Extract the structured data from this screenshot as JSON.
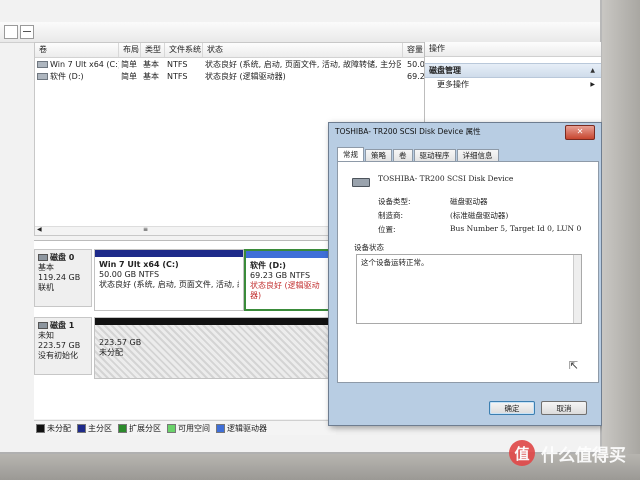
{
  "volume_list": {
    "headers": [
      "卷",
      "布局",
      "类型",
      "文件系统",
      "状态",
      "容量"
    ],
    "rows": [
      {
        "name": "Win 7 Ult x64 (C:)",
        "layout": "简单",
        "type": "基本",
        "fs": "NTFS",
        "status": "状态良好 (系统, 启动, 页面文件, 活动, 故障转储, 主分区)",
        "capacity": "50.0"
      },
      {
        "name": "软件 (D:)",
        "layout": "简单",
        "type": "基本",
        "fs": "NTFS",
        "status": "状态良好 (逻辑驱动器)",
        "capacity": "69.2"
      }
    ]
  },
  "actions": {
    "header": "操作",
    "section": "磁盘管理",
    "item": "更多操作"
  },
  "disks": [
    {
      "name": "磁盘 0",
      "type": "基本",
      "size": "119.24 GB",
      "state": "联机",
      "partitions": [
        {
          "name": "Win 7 Ult x64 (C:)",
          "size": "50.00 GB NTFS",
          "status": "状态良好 (系统, 启动, 页面文件, 活动, 故障转储, 主分区)"
        },
        {
          "name": "软件 (D:)",
          "size": "69.23 GB NTFS",
          "status": "状态良好 (逻辑驱动器)"
        }
      ]
    },
    {
      "name": "磁盘 1",
      "type": "未知",
      "size": "223.57 GB",
      "state": "没有初始化",
      "partitions": [
        {
          "size": "223.57 GB",
          "status": "未分配"
        }
      ]
    }
  ],
  "legend": [
    {
      "label": "未分配",
      "color": "#111111"
    },
    {
      "label": "主分区",
      "color": "#1e2a8a"
    },
    {
      "label": "扩展分区",
      "color": "#2b8a2b"
    },
    {
      "label": "可用空间",
      "color": "#6ad36a"
    },
    {
      "label": "逻辑驱动器",
      "color": "#3f6fd8"
    }
  ],
  "dialog": {
    "title": "TOSHIBA- TR200 SCSI Disk Device 属性",
    "close_label": "✕",
    "tabs": [
      "常规",
      "策略",
      "卷",
      "驱动程序",
      "详细信息"
    ],
    "device_name": "TOSHIBA- TR200 SCSI Disk Device",
    "props": [
      {
        "label": "设备类型:",
        "value": "磁盘驱动器"
      },
      {
        "label": "制造商:",
        "value": "(标准磁盘驱动器)"
      },
      {
        "label": "位置:",
        "value": "Bus Number 5, Target Id 0, LUN 0"
      }
    ],
    "status_label": "设备状态",
    "status_text": "这个设备运转正常。",
    "ok": "确定",
    "cancel": "取消"
  },
  "colors": {
    "primary_bar": "#1e2a8a",
    "logical_bar": "#3f6fd8",
    "unallocated_bar": "#111111",
    "dialog_frame": "#b8cde3"
  },
  "watermark": {
    "icon": "值",
    "text": "什么值得买"
  }
}
